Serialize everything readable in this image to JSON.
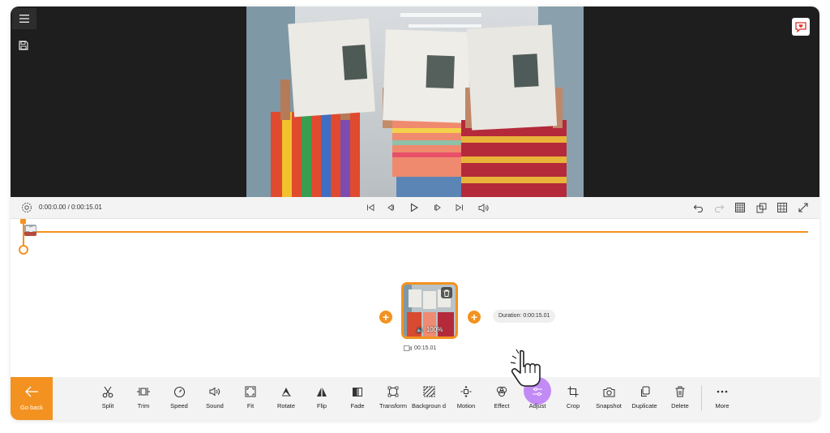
{
  "header": {
    "menu_icon": "hamburger-icon",
    "save_icon": "save-icon",
    "feedback_icon": "heart-chat-icon"
  },
  "player": {
    "time_display": "0:00:0.00 / 0:00:15.01",
    "settings_icon": "gear-icon",
    "playback_icons": [
      "skip-start-icon",
      "step-back-icon",
      "play-icon",
      "step-forward-icon",
      "skip-end-icon",
      "volume-icon"
    ],
    "right_icons": [
      "undo-icon",
      "redo-icon",
      "checkerboard-icon",
      "aspect-ratio-icon",
      "grid-icon",
      "fullscreen-icon"
    ]
  },
  "timeline": {
    "clip": {
      "volume_label": "🔉 100%",
      "duration_label": "00:15.01",
      "delete_icon": "trash-icon"
    },
    "duration_pill": "Duration: 0:00:15.01",
    "add_icon": "plus-icon"
  },
  "toolbar": {
    "go_back_label": "Go back",
    "tools": [
      {
        "label": "Split",
        "icon": "scissors-icon"
      },
      {
        "label": "Trim",
        "icon": "trim-icon"
      },
      {
        "label": "Speed",
        "icon": "speedometer-icon"
      },
      {
        "label": "Sound",
        "icon": "speaker-icon"
      },
      {
        "label": "Fit",
        "icon": "fit-icon"
      },
      {
        "label": "Rotate",
        "icon": "rotate-icon"
      },
      {
        "label": "Flip",
        "icon": "flip-icon"
      },
      {
        "label": "Fade",
        "icon": "fade-icon"
      },
      {
        "label": "Transform",
        "icon": "transform-icon"
      },
      {
        "label": "Backgroun d",
        "icon": "background-icon"
      },
      {
        "label": "Motion",
        "icon": "motion-icon"
      },
      {
        "label": "Effect",
        "icon": "effect-icon"
      },
      {
        "label": "Adjust",
        "icon": "adjust-sliders-icon"
      },
      {
        "label": "Crop",
        "icon": "crop-icon"
      },
      {
        "label": "Snapshot",
        "icon": "camera-icon"
      },
      {
        "label": "Duplicate",
        "icon": "duplicate-icon"
      },
      {
        "label": "Delete",
        "icon": "trash-icon"
      },
      {
        "label": "More",
        "icon": "more-dots-icon"
      }
    ]
  },
  "colors": {
    "accent": "#f39220",
    "adjust_highlight": "#c28af5",
    "preview_bg": "#1e1e1e"
  }
}
